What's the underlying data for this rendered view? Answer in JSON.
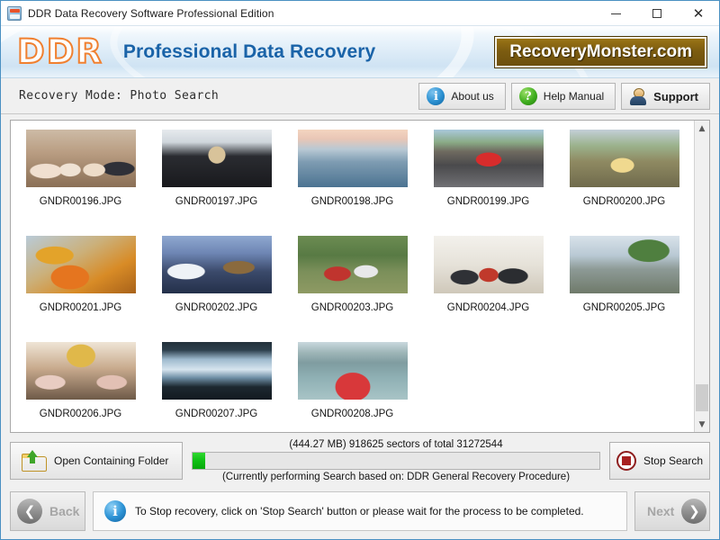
{
  "window": {
    "title": "DDR Data Recovery Software Professional Edition",
    "icon": "app-icon",
    "minimize": "—",
    "maximize": "□",
    "close": "✕"
  },
  "brand": {
    "logo": "DDR",
    "title": "Professional Data Recovery",
    "banner": "RecoveryMonster.com",
    "banner_color": "#7c5c10",
    "title_color": "#1a63a8",
    "logo_color": "#f08030"
  },
  "modebar": {
    "mode_text": "Recovery Mode: Photo Search",
    "buttons": [
      {
        "label": "About us",
        "icon": "info-icon",
        "glyph": "i"
      },
      {
        "label": "Help Manual",
        "icon": "question-icon",
        "glyph": "?"
      },
      {
        "label": "Support",
        "icon": "support-person-icon",
        "glyph": ""
      }
    ]
  },
  "files": {
    "rows": [
      [
        {
          "name": "GNDR00196.JPG",
          "art": "t196"
        },
        {
          "name": "GNDR00197.JPG",
          "art": "t197"
        },
        {
          "name": "GNDR00198.JPG",
          "art": "t198"
        },
        {
          "name": "GNDR00199.JPG",
          "art": "t199"
        },
        {
          "name": "GNDR00200.JPG",
          "art": "t200"
        }
      ],
      [
        {
          "name": "GNDR00201.JPG",
          "art": "t201"
        },
        {
          "name": "GNDR00202.JPG",
          "art": "t202"
        },
        {
          "name": "GNDR00203.JPG",
          "art": "t203"
        },
        {
          "name": "GNDR00204.JPG",
          "art": "t204"
        },
        {
          "name": "GNDR00205.JPG",
          "art": "t205"
        }
      ],
      [
        {
          "name": "GNDR00206.JPG",
          "art": "t206"
        },
        {
          "name": "GNDR00207.JPG",
          "art": "t207"
        },
        {
          "name": "GNDR00208.JPG",
          "art": "t208"
        }
      ]
    ],
    "scroll_up": "▲",
    "scroll_down": "▼"
  },
  "actions": {
    "open_folder_label": "Open Containing Folder",
    "open_folder_icon": "folder-upload-icon",
    "stop_label": "Stop Search",
    "stop_icon": "stop-record-icon",
    "progress_label": "(444.27 MB) 918625  sectors  of  total 31272544",
    "progress_sub": "(Currently performing Search based on:  DDR General Recovery Procedure)",
    "progress_percent": 3,
    "progress_color": "#0fbf14",
    "size_mb": "444.27 MB",
    "sectors_done": "918625",
    "sectors_total": "31272544"
  },
  "footer": {
    "back_label": "Back",
    "back_icon": "chevron-left-icon",
    "back_glyph": "❮",
    "next_label": "Next",
    "next_icon": "chevron-right-icon",
    "next_glyph": "❯",
    "hint_icon": "info-icon",
    "hint_glyph": "i",
    "hint_text": "To Stop recovery, click on 'Stop Search' button or please wait for the process to be completed."
  }
}
